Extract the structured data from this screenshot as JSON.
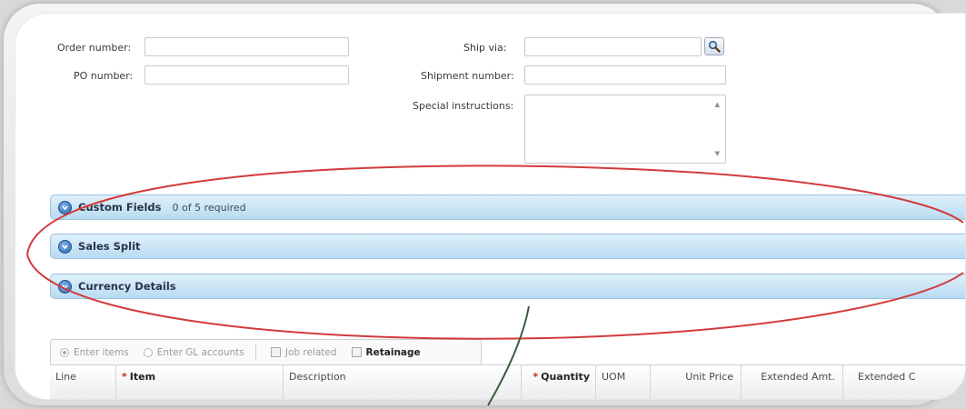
{
  "form": {
    "order_number_label": "Order number:",
    "po_number_label": "PO number:",
    "ship_via_label": "Ship via:",
    "shipment_number_label": "Shipment number:",
    "special_instructions_label": "Special instructions:"
  },
  "sections": [
    {
      "title": "Custom Fields",
      "subtitle": "0 of 5 required"
    },
    {
      "title": "Sales Split",
      "subtitle": ""
    },
    {
      "title": "Currency Details",
      "subtitle": ""
    }
  ],
  "tabs": {
    "enter_items": "Enter items",
    "enter_gl": "Enter GL accounts",
    "job_related": "Job related",
    "retainage": "Retainage"
  },
  "grid": {
    "columns": [
      "Line",
      "Item",
      "Description",
      "Quantity",
      "UOM",
      "Unit Price",
      "Extended Amt.",
      "Extended C"
    ]
  },
  "colors": {
    "highlight_ellipse": "#d33a3a",
    "pointer_line": "#3c5a3c",
    "section_fill": "#c9e5f7",
    "required_star": "#d02020"
  },
  "icons": {
    "lookup": "magnifier-icon",
    "section_toggle": "expand-circle-icon"
  }
}
